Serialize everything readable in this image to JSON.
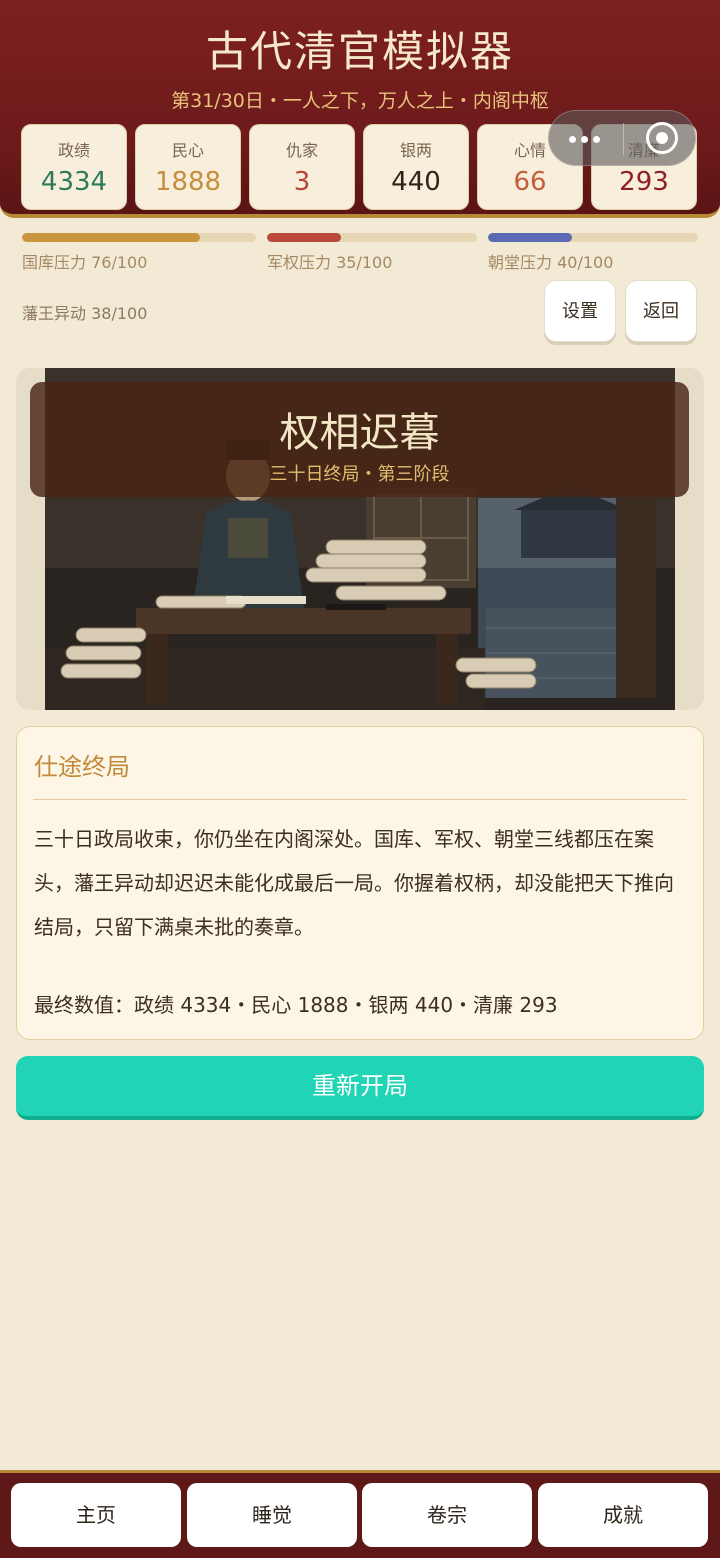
{
  "header": {
    "title": "古代清官模拟器",
    "subtitle": "第31/30日・一人之下，万人之上・内阁中枢"
  },
  "stats": [
    {
      "label": "政绩",
      "value": "4334",
      "color": "#2f7a5a"
    },
    {
      "label": "民心",
      "value": "1888",
      "color": "#c58f3e"
    },
    {
      "label": "仇家",
      "value": "3",
      "color": "#b6453b"
    },
    {
      "label": "银两",
      "value": "440",
      "color": "#2d2419"
    },
    {
      "label": "心情",
      "value": "66",
      "color": "#c2603c"
    },
    {
      "label": "清廉",
      "value": "293",
      "color": "#8f1f22"
    }
  ],
  "pressures": [
    {
      "label": "国库压力 76/100",
      "value": 76,
      "color": "#c9963e"
    },
    {
      "label": "军权压力 35/100",
      "value": 35,
      "color": "#b94a3b"
    },
    {
      "label": "朝堂压力 40/100",
      "value": 40,
      "color": "#5b6bb3"
    }
  ],
  "fanwang": {
    "label": "藩王异动 38/100",
    "value": 38
  },
  "buttons": {
    "settings": "设置",
    "back": "返回",
    "restart": "重新开局"
  },
  "scene": {
    "title": "权相迟暮",
    "subtitle": "三十日终局・第三阶段"
  },
  "result": {
    "title": "仕途终局",
    "body": "三十日政局收束，你仍坐在内阁深处。国库、军权、朝堂三线都压在案头，藩王异动却迟迟未能化成最后一局。你握着权柄，却没能把天下推向结局，只留下满桌未批的奏章。",
    "final": "最终数值：政绩 4334・民心 1888・银两 440・清廉 293"
  },
  "nav": [
    "主页",
    "睡觉",
    "卷宗",
    "成就"
  ],
  "capsule": {
    "menu_icon": "more-dots-icon",
    "close_icon": "close-circle-icon"
  }
}
